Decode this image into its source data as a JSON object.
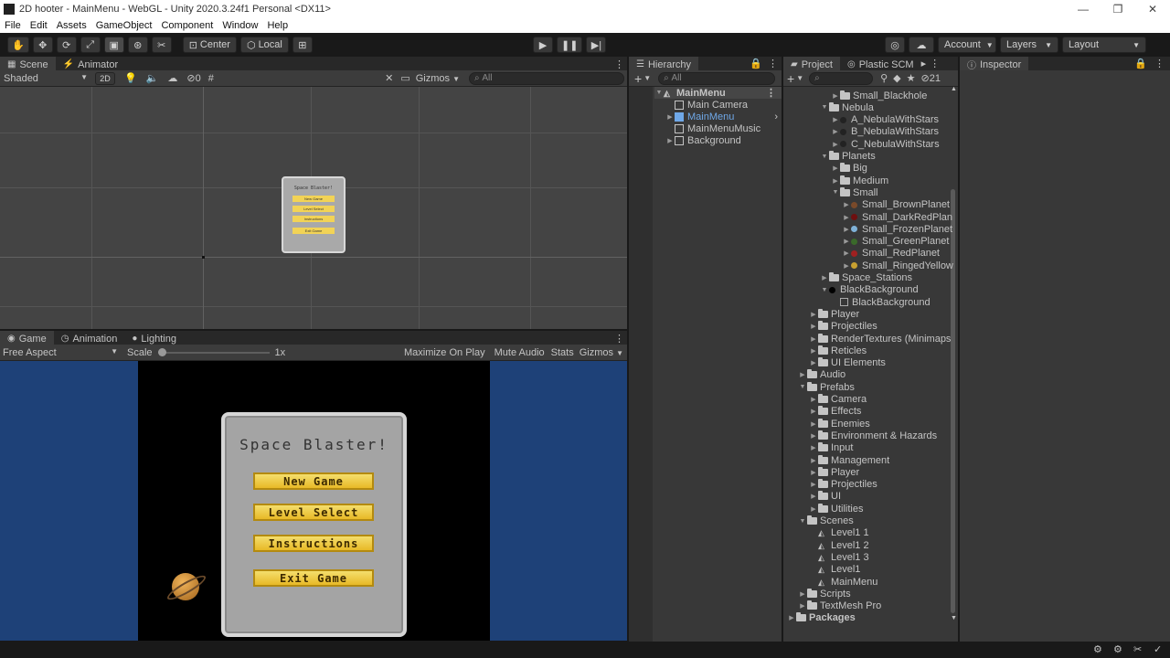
{
  "window": {
    "title": "2D hooter - MainMenu - WebGL - Unity 2020.3.24f1 Personal <DX11>",
    "minimize": "—",
    "maximize": "❐",
    "close": "✕"
  },
  "menu": [
    "File",
    "Edit",
    "Assets",
    "GameObject",
    "Component",
    "Window",
    "Help"
  ],
  "toolbar": {
    "pivot_center": "Center",
    "pivot_local": "Local",
    "account": "Account",
    "layers": "Layers",
    "layout": "Layout"
  },
  "scene_panel": {
    "tabs": [
      "Scene",
      "Animator"
    ],
    "shading": "Shaded",
    "mode_2d": "2D",
    "hidden_count": "0",
    "gizmos": "Gizmos",
    "search_placeholder": "All",
    "preview_title": "Space Blaster!",
    "preview_buttons": [
      "New Game",
      "Level Select",
      "Instructions",
      "Exit Game"
    ]
  },
  "game_panel": {
    "tabs": [
      "Game",
      "Animation",
      "Lighting"
    ],
    "aspect": "Free Aspect",
    "scale_label": "Scale",
    "scale_value": "1x",
    "maximize_on_play": "Maximize On Play",
    "mute_audio": "Mute Audio",
    "stats": "Stats",
    "gizmos": "Gizmos",
    "title": "Space Blaster!",
    "buttons": [
      "New Game",
      "Level Select",
      "Instructions",
      "Exit Game"
    ]
  },
  "hierarchy": {
    "tab": "Hierarchy",
    "search_placeholder": "All",
    "scene": "MainMenu",
    "items": [
      "Main Camera",
      "MainMenu",
      "MainMenuMusic",
      "Background"
    ]
  },
  "project": {
    "tab": "Project",
    "tab2": "Plastic SCM",
    "hidden_count": "21",
    "rows": [
      {
        "label": "Small_Blackhole",
        "indent": 4,
        "kind": "folder",
        "arrow": "right"
      },
      {
        "label": "Nebula",
        "indent": 3,
        "kind": "folder",
        "arrow": "down"
      },
      {
        "label": "A_NebulaWithStars",
        "indent": 4,
        "kind": "sprite",
        "arrow": "right",
        "color": "#222222"
      },
      {
        "label": "B_NebulaWithStars",
        "indent": 4,
        "kind": "sprite",
        "arrow": "right",
        "color": "#222222"
      },
      {
        "label": "C_NebulaWithStars",
        "indent": 4,
        "kind": "sprite",
        "arrow": "right",
        "color": "#222222"
      },
      {
        "label": "Planets",
        "indent": 3,
        "kind": "folder",
        "arrow": "down"
      },
      {
        "label": "Big",
        "indent": 4,
        "kind": "folder",
        "arrow": "right"
      },
      {
        "label": "Medium",
        "indent": 4,
        "kind": "folder",
        "arrow": "right"
      },
      {
        "label": "Small",
        "indent": 4,
        "kind": "folder",
        "arrow": "down"
      },
      {
        "label": "Small_BrownPlanet",
        "indent": 5,
        "kind": "sprite",
        "arrow": "right",
        "color": "#7a4a2a"
      },
      {
        "label": "Small_DarkRedPlan",
        "indent": 5,
        "kind": "sprite",
        "arrow": "right",
        "color": "#6e1010"
      },
      {
        "label": "Small_FrozenPlanet",
        "indent": 5,
        "kind": "sprite",
        "arrow": "right",
        "color": "#7fb2d8"
      },
      {
        "label": "Small_GreenPlanet",
        "indent": 5,
        "kind": "sprite",
        "arrow": "right",
        "color": "#3a6a2a"
      },
      {
        "label": "Small_RedPlanet",
        "indent": 5,
        "kind": "sprite",
        "arrow": "right",
        "color": "#a02020"
      },
      {
        "label": "Small_RingedYellow",
        "indent": 5,
        "kind": "sprite",
        "arrow": "right",
        "color": "#c8a030"
      },
      {
        "label": "Space_Stations",
        "indent": 3,
        "kind": "folder",
        "arrow": "right"
      },
      {
        "label": "BlackBackground",
        "indent": 3,
        "kind": "sprite",
        "arrow": "down",
        "color": "#000000"
      },
      {
        "label": "BlackBackground",
        "indent": 4,
        "kind": "sub",
        "arrow": "none"
      },
      {
        "label": "Player",
        "indent": 2,
        "kind": "folder",
        "arrow": "right"
      },
      {
        "label": "Projectiles",
        "indent": 2,
        "kind": "folder",
        "arrow": "right"
      },
      {
        "label": "RenderTextures (Minimaps",
        "indent": 2,
        "kind": "folder",
        "arrow": "right"
      },
      {
        "label": "Reticles",
        "indent": 2,
        "kind": "folder",
        "arrow": "right"
      },
      {
        "label": "UI Elements",
        "indent": 2,
        "kind": "folder",
        "arrow": "right"
      },
      {
        "label": "Audio",
        "indent": 1,
        "kind": "folder",
        "arrow": "right"
      },
      {
        "label": "Prefabs",
        "indent": 1,
        "kind": "folder",
        "arrow": "down"
      },
      {
        "label": "Camera",
        "indent": 2,
        "kind": "folder",
        "arrow": "right"
      },
      {
        "label": "Effects",
        "indent": 2,
        "kind": "folder",
        "arrow": "right"
      },
      {
        "label": "Enemies",
        "indent": 2,
        "kind": "folder",
        "arrow": "right"
      },
      {
        "label": "Environment & Hazards",
        "indent": 2,
        "kind": "folder",
        "arrow": "right"
      },
      {
        "label": "Input",
        "indent": 2,
        "kind": "folder",
        "arrow": "right"
      },
      {
        "label": "Management",
        "indent": 2,
        "kind": "folder",
        "arrow": "right"
      },
      {
        "label": "Player",
        "indent": 2,
        "kind": "folder",
        "arrow": "right"
      },
      {
        "label": "Projectiles",
        "indent": 2,
        "kind": "folder",
        "arrow": "right"
      },
      {
        "label": "UI",
        "indent": 2,
        "kind": "folder",
        "arrow": "right"
      },
      {
        "label": "Utilities",
        "indent": 2,
        "kind": "folder",
        "arrow": "right"
      },
      {
        "label": "Scenes",
        "indent": 1,
        "kind": "folder",
        "arrow": "down"
      },
      {
        "label": "Level1 1",
        "indent": 2,
        "kind": "scene",
        "arrow": "none"
      },
      {
        "label": "Level1 2",
        "indent": 2,
        "kind": "scene",
        "arrow": "none"
      },
      {
        "label": "Level1 3",
        "indent": 2,
        "kind": "scene",
        "arrow": "none"
      },
      {
        "label": "Level1",
        "indent": 2,
        "kind": "scene",
        "arrow": "none"
      },
      {
        "label": "MainMenu",
        "indent": 2,
        "kind": "scene",
        "arrow": "none"
      },
      {
        "label": "Scripts",
        "indent": 1,
        "kind": "folder",
        "arrow": "right"
      },
      {
        "label": "TextMesh Pro",
        "indent": 1,
        "kind": "folder",
        "arrow": "right"
      },
      {
        "label": "Packages",
        "indent": 0,
        "kind": "folder",
        "arrow": "right",
        "bold": true
      }
    ]
  },
  "inspector": {
    "tab": "Inspector"
  },
  "colors": {
    "game_bg": "#1e4178",
    "selected_text": "#6fa8e8",
    "button_fill": "#f2d356"
  }
}
